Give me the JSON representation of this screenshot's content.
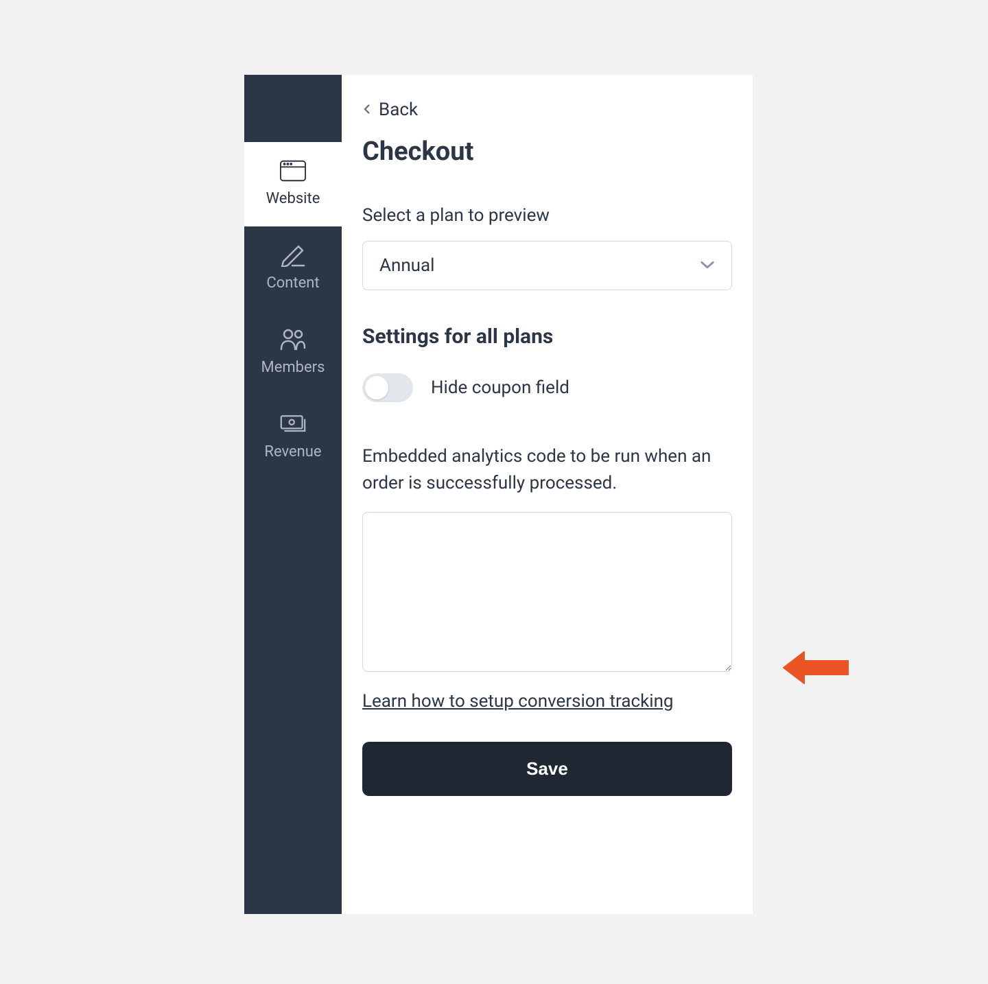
{
  "sidebar": {
    "items": [
      {
        "label": "Website"
      },
      {
        "label": "Content"
      },
      {
        "label": "Members"
      },
      {
        "label": "Revenue"
      }
    ]
  },
  "header": {
    "back_label": "Back",
    "title": "Checkout"
  },
  "plan_section": {
    "label": "Select a plan to preview",
    "selected": "Annual"
  },
  "settings_section": {
    "heading": "Settings for all plans",
    "hide_coupon_label": "Hide coupon field",
    "hide_coupon_value": false,
    "analytics_description": "Embedded analytics code to be run when an order is successfully processed.",
    "analytics_code": "",
    "learn_link": "Learn how to setup conversion tracking"
  },
  "actions": {
    "save_label": "Save"
  },
  "colors": {
    "sidebar_bg": "#2b3646",
    "text_primary": "#2b3646",
    "text_muted": "#aeb6c2",
    "border": "#d6dae0",
    "button_bg": "#1f2733",
    "arrow": "#eb5424"
  }
}
